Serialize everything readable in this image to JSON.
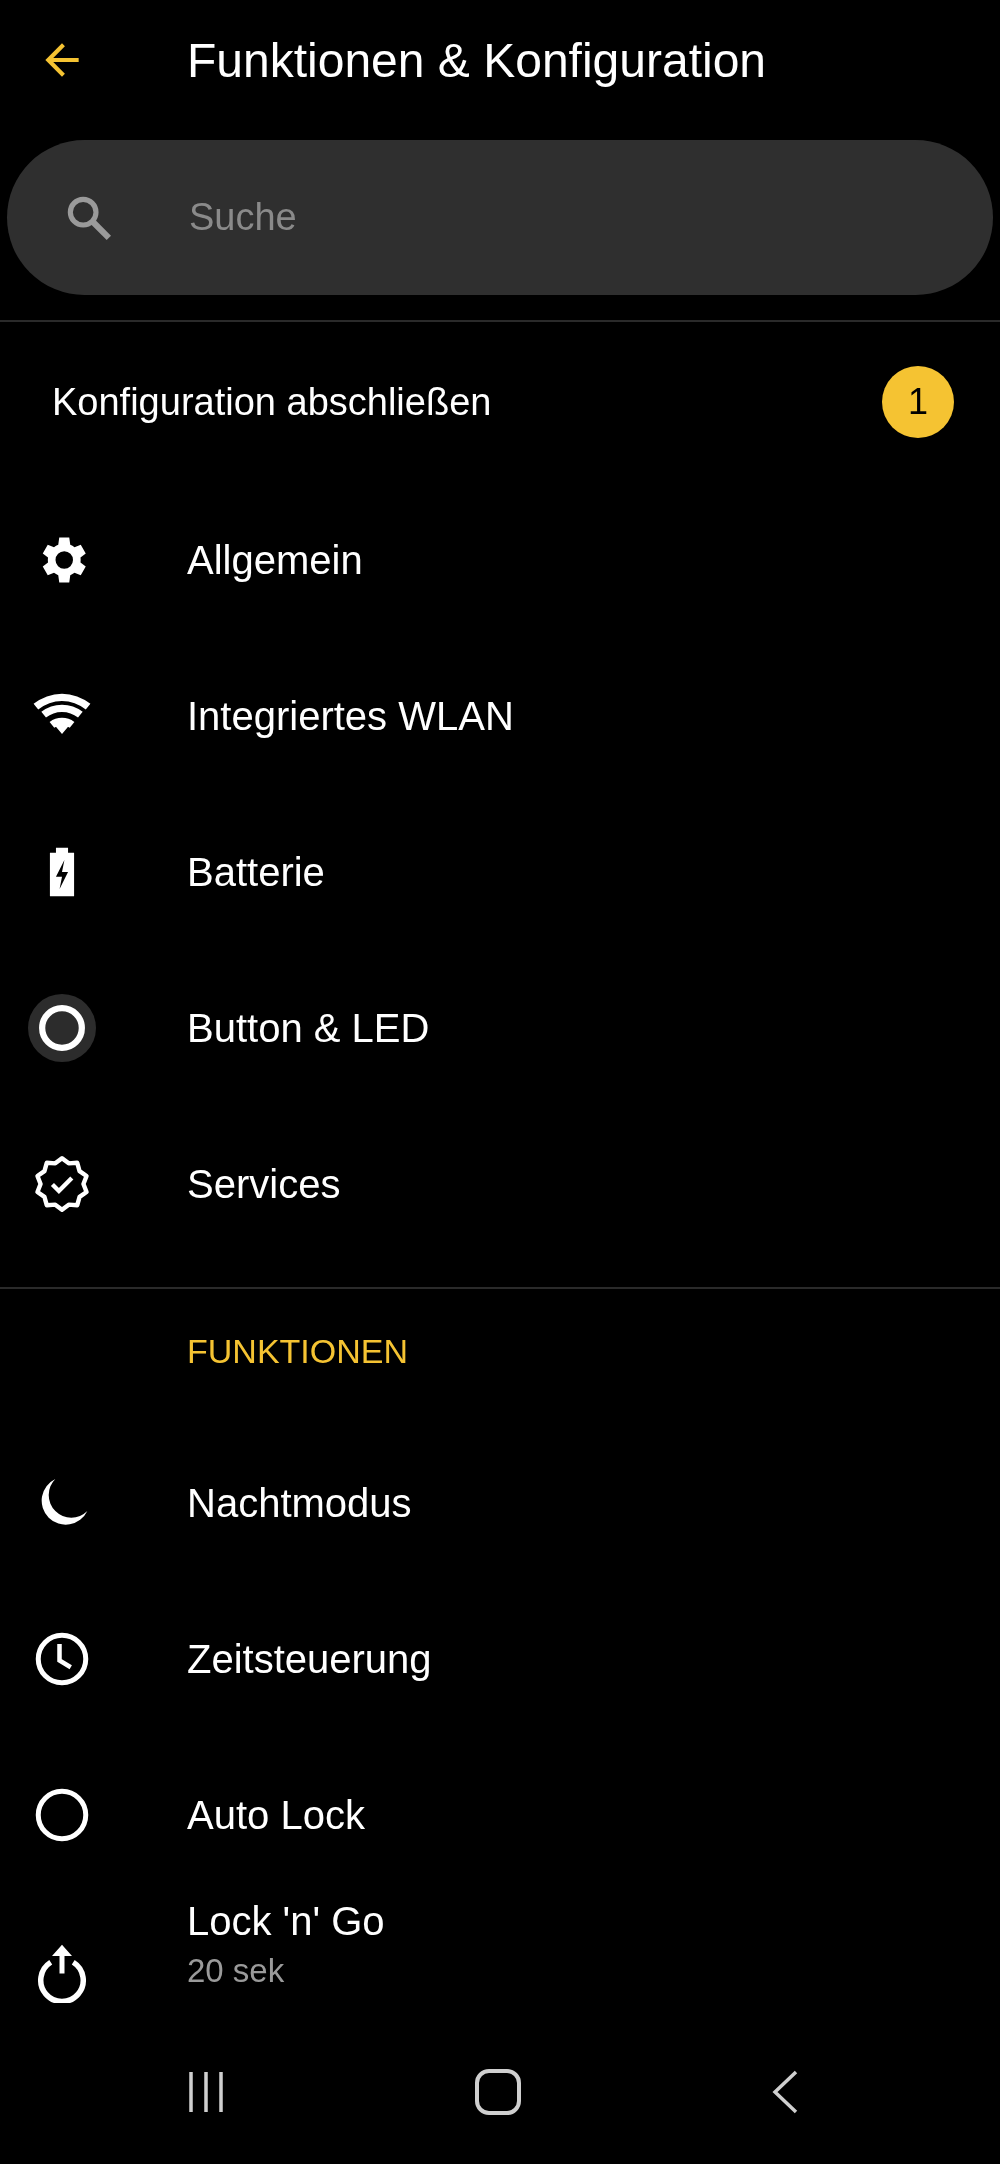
{
  "header": {
    "title": "Funktionen & Konfiguration"
  },
  "search": {
    "placeholder": "Suche"
  },
  "setup": {
    "label": "Konfiguration abschließen",
    "badge": "1"
  },
  "settings": [
    {
      "label": "Allgemein",
      "kind": "gear"
    },
    {
      "label": "Integriertes WLAN",
      "kind": "wifi"
    },
    {
      "label": "Batterie",
      "kind": "battery"
    },
    {
      "label": "Button & LED",
      "kind": "button"
    },
    {
      "label": "Services",
      "kind": "verified"
    }
  ],
  "features": {
    "heading": "FUNKTIONEN",
    "items": [
      {
        "label": "Nachtmodus",
        "kind": "moon"
      },
      {
        "label": "Zeitsteuerung",
        "kind": "clock"
      },
      {
        "label": "Auto Lock",
        "kind": "ring"
      },
      {
        "label": "Lock 'n' Go",
        "kind": "power",
        "sub": "20 sek"
      }
    ]
  }
}
